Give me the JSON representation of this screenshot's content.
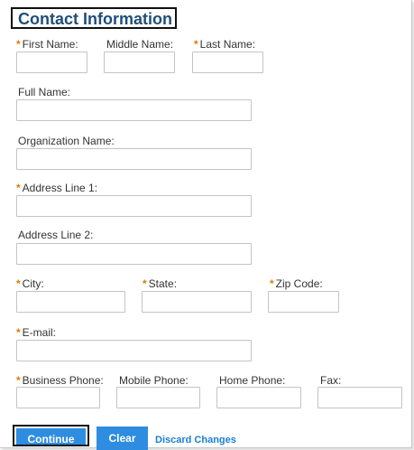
{
  "section_title": "Contact Information",
  "required_marker": "*",
  "labels": {
    "first_name": "First Name:",
    "middle_name": "Middle Name:",
    "last_name": "Last Name:",
    "full_name": "Full Name:",
    "organization_name": "Organization Name:",
    "address_line_1": "Address Line 1:",
    "address_line_2": "Address Line 2:",
    "city": "City:",
    "state": "State:",
    "zip_code": "Zip Code:",
    "email": "E-mail:",
    "business_phone": "Business Phone:",
    "mobile_phone": "Mobile Phone:",
    "home_phone": "Home Phone:",
    "fax": "Fax:"
  },
  "values": {
    "first_name": "",
    "middle_name": "",
    "last_name": "",
    "full_name": "",
    "organization_name": "",
    "address_line_1": "",
    "address_line_2": "",
    "city": "",
    "state": "",
    "zip_code": "",
    "email": "",
    "business_phone": "",
    "mobile_phone": "",
    "home_phone": "",
    "fax": ""
  },
  "buttons": {
    "continue": "Continue",
    "clear": "Clear",
    "discard": "Discard Changes"
  },
  "colors": {
    "title": "#1f4e79",
    "required_marker": "#e07b00",
    "button": "#2e8de0",
    "link": "#1a7fd4"
  }
}
